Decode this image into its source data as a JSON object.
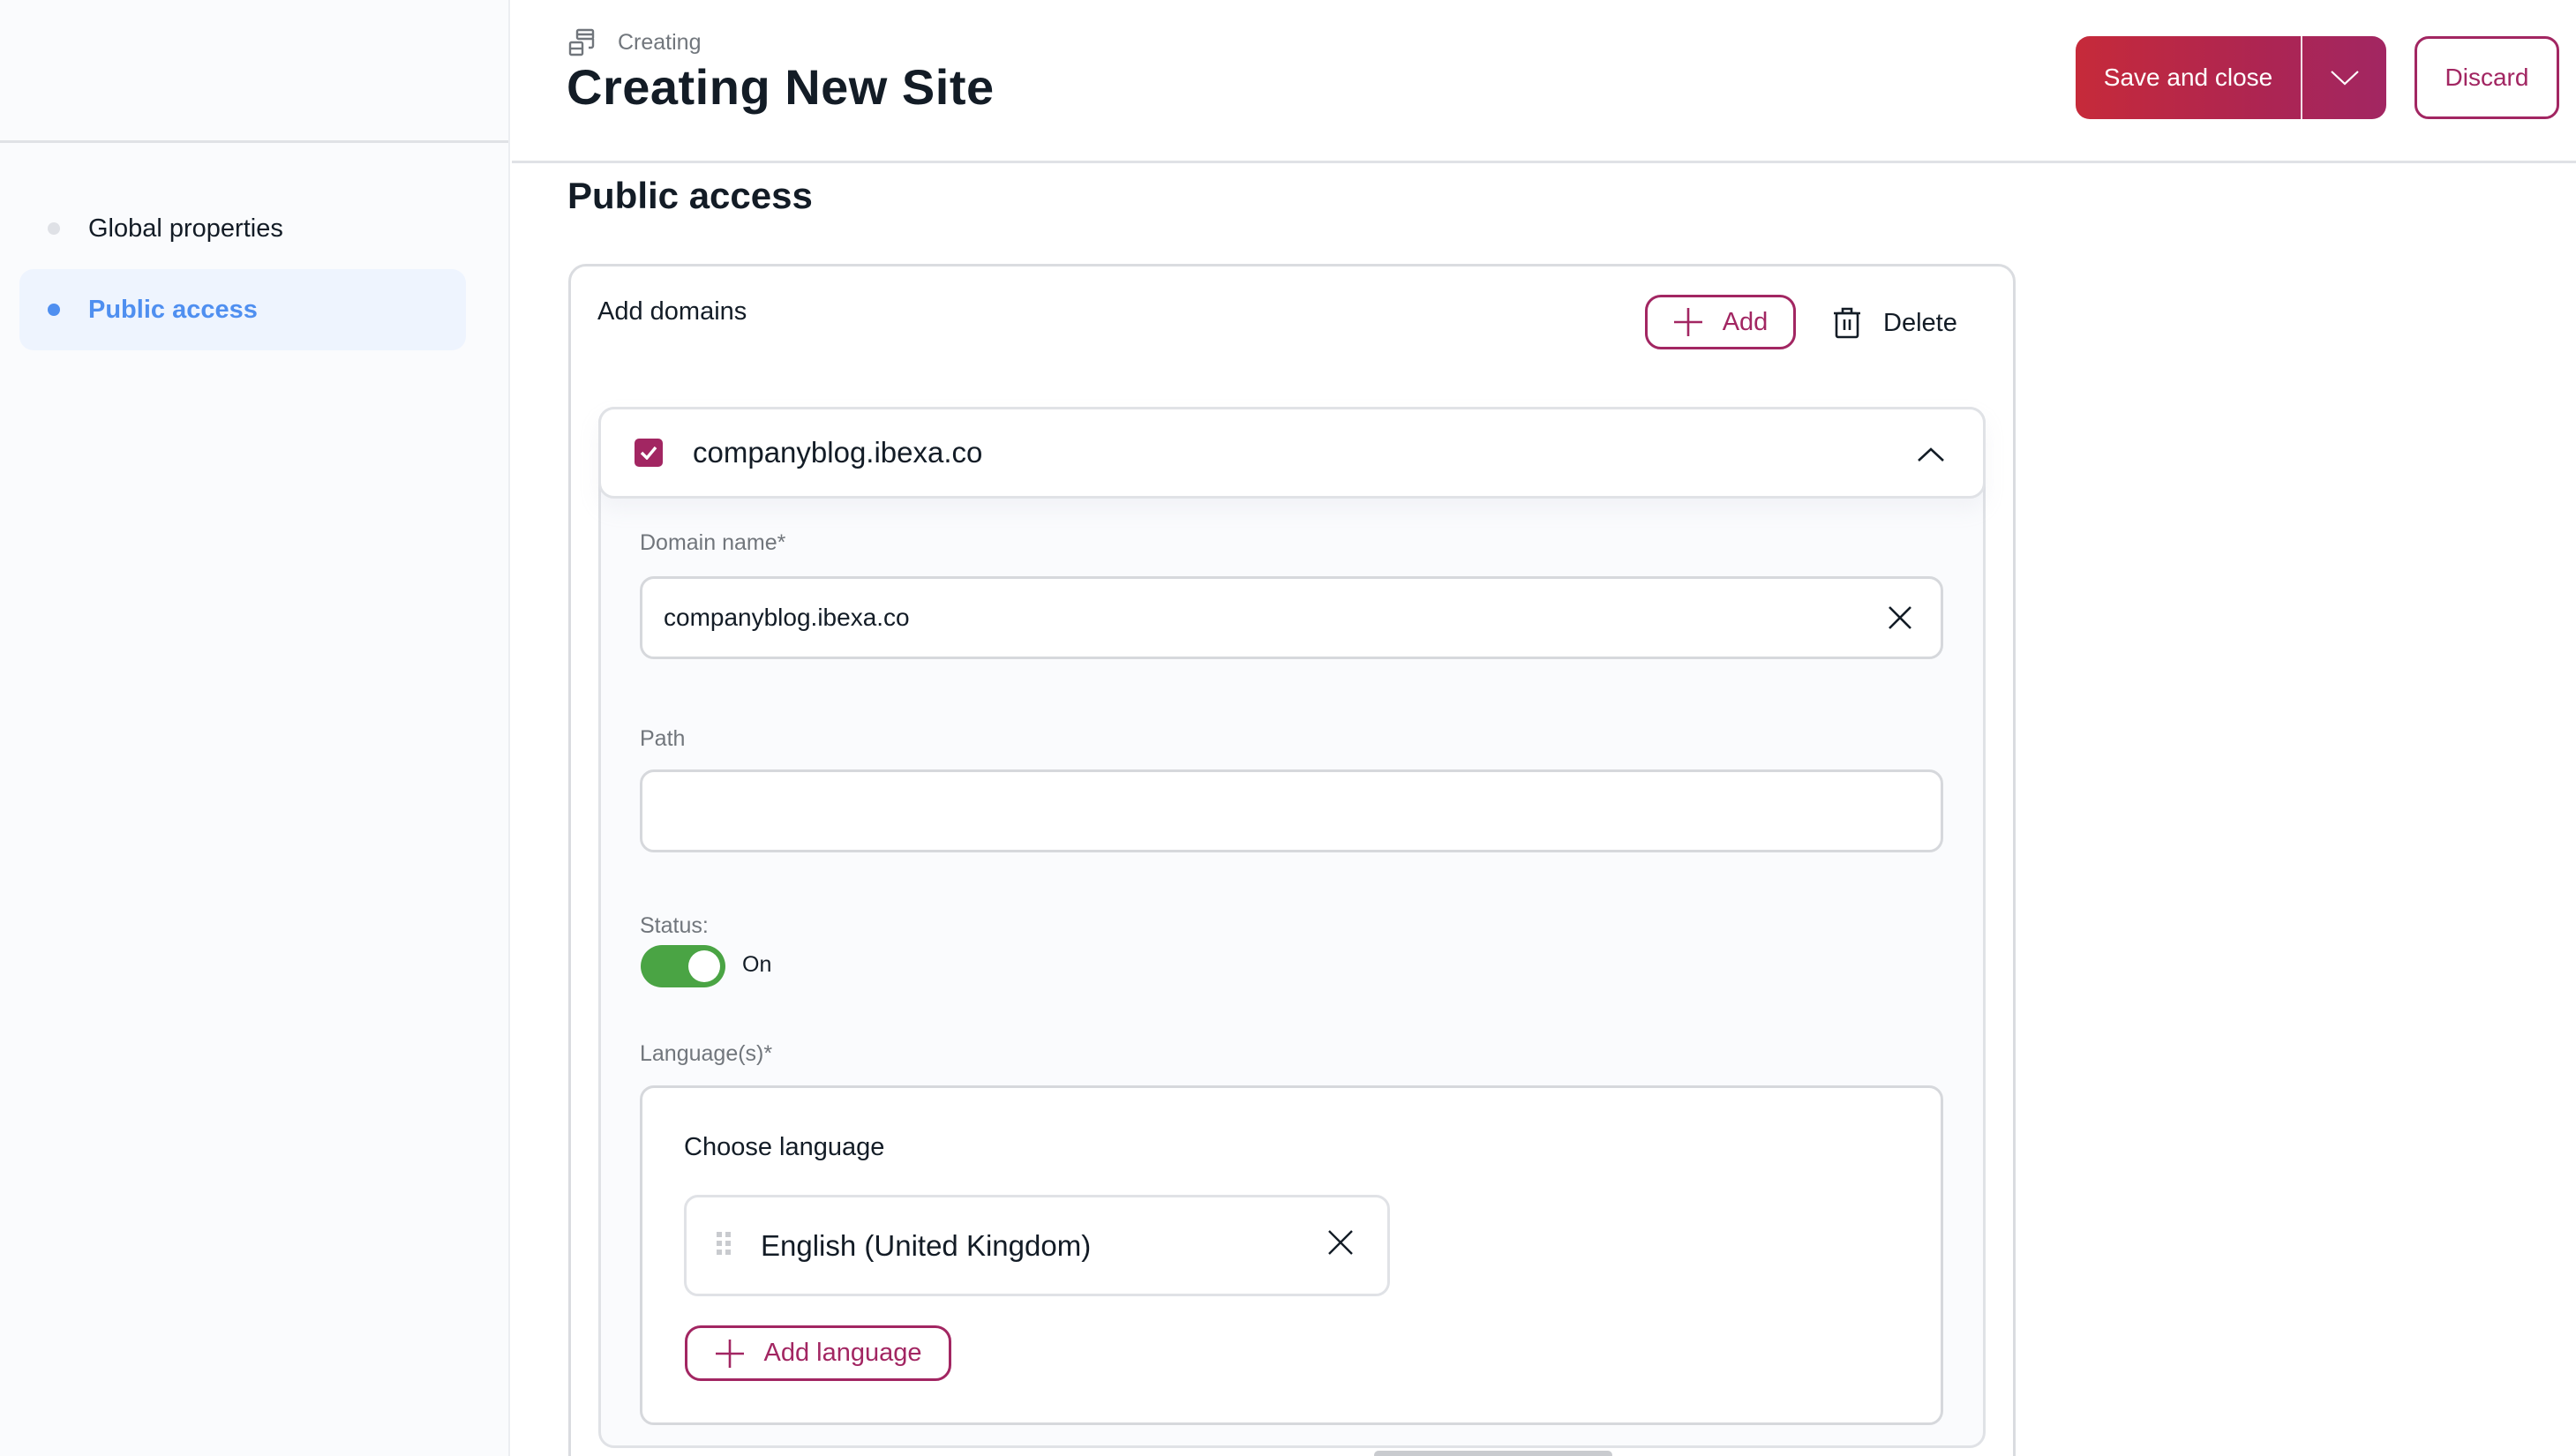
{
  "sidebar": {
    "items": [
      {
        "label": "Global properties",
        "active": false
      },
      {
        "label": "Public access",
        "active": true
      }
    ]
  },
  "header": {
    "breadcrumb": "Creating",
    "breadcrumb_icon": "content-type-icon",
    "title": "Creating New Site",
    "save_label": "Save and close",
    "discard_label": "Discard"
  },
  "section": {
    "title": "Public access"
  },
  "domains": {
    "label": "Add domains",
    "add_label": "Add",
    "delete_label": "Delete",
    "items": [
      {
        "title": "companyblog.ibexa.co",
        "checked": true,
        "expanded": true,
        "fields": {
          "domain_name_label": "Domain name*",
          "domain_name_value": "companyblog.ibexa.co",
          "path_label": "Path",
          "path_value": "",
          "status_label": "Status:",
          "status_on": true,
          "status_text": "On",
          "languages_label": "Language(s)*",
          "choose_language_label": "Choose language",
          "languages": [
            "English (United Kingdom)"
          ],
          "add_language_label": "Add language"
        }
      }
    ]
  },
  "colors": {
    "accent": "#a22662",
    "accent_gradient_start": "#c62a3a",
    "sidebar_active": "#4f8ff0",
    "toggle_on": "#4aa444"
  }
}
